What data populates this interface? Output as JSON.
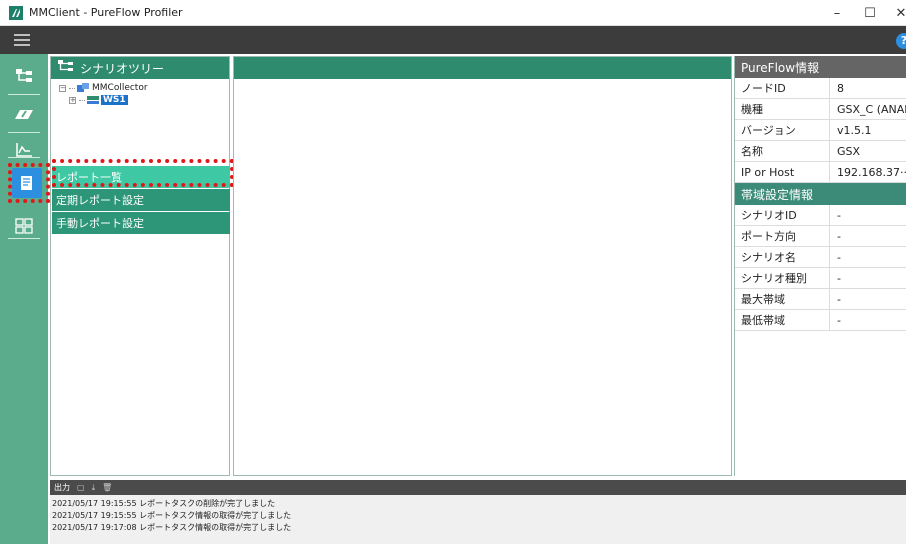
{
  "window": {
    "title": "MMClient - PureFlow Profiler",
    "minimize": "–",
    "maximize": "☐",
    "close": "✕"
  },
  "topbar": {
    "help": "?"
  },
  "tree_panel": {
    "title": "シナリオツリー",
    "nodes": [
      {
        "label": "MMCollector",
        "toggle": "−"
      },
      {
        "label": "WS1",
        "toggle": "+"
      }
    ],
    "menu": [
      {
        "label": "レポート一覧",
        "selected": true
      },
      {
        "label": "定期レポート設定",
        "selected": false
      },
      {
        "label": "手動レポート設定",
        "selected": false
      }
    ]
  },
  "info_panel": {
    "pureflow_title": "PureFlow情報",
    "pureflow_rows": [
      {
        "key": "ノードID",
        "value": "8"
      },
      {
        "key": "機種",
        "value": "GSX_C (ANALY"
      },
      {
        "key": "バージョン",
        "value": "v1.5.1"
      },
      {
        "key": "名称",
        "value": "GSX"
      },
      {
        "key": "IP or Host",
        "value": "192.168.37···"
      }
    ],
    "band_title": "帯域設定情報",
    "band_rows": [
      {
        "key": "シナリオID",
        "value": "-"
      },
      {
        "key": "ポート方向",
        "value": "-"
      },
      {
        "key": "シナリオ名",
        "value": "-"
      },
      {
        "key": "シナリオ種別",
        "value": "-"
      },
      {
        "key": "最大帯域",
        "value": "-"
      },
      {
        "key": "最低帯域",
        "value": "-"
      }
    ]
  },
  "output": {
    "title": "出力",
    "log": [
      "2021/05/17 19:15:55 レポートタスクの削除が完了しました",
      "2021/05/17 19:15:55 レポートタスク情報の取得が完了しました",
      "2021/05/17 19:17:08 レポートタスク情報の取得が完了しました"
    ]
  },
  "colors": {
    "nav_green": "#5bab8d",
    "header_teal": "#2e8b6e",
    "menu_selected": "#3fc8a4",
    "menu_normal": "#2e9678",
    "active_blue": "#2d8fe0",
    "highlight_red": "#e01818"
  }
}
